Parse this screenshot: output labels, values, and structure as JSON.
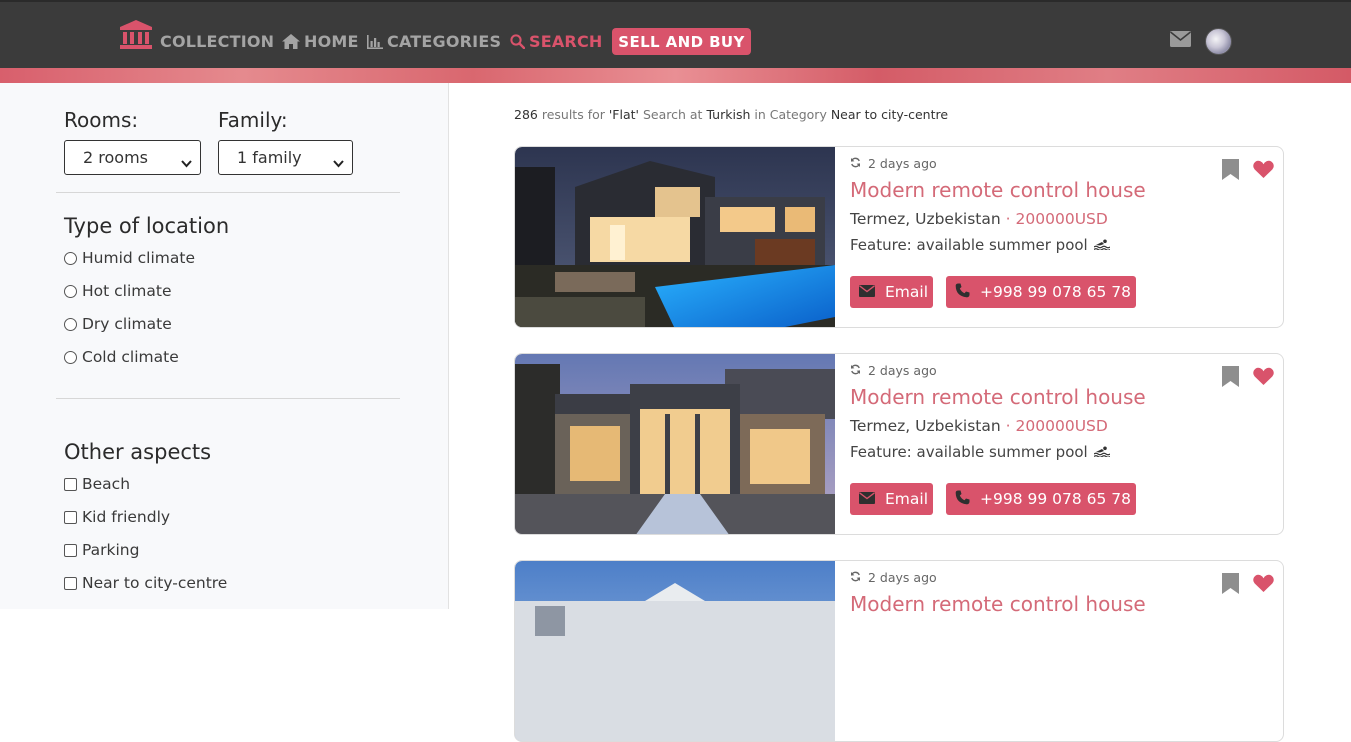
{
  "nav": {
    "logo_icon": "bank-building-icon",
    "items": [
      {
        "label": "COLLECTION",
        "icon": "",
        "active": false
      },
      {
        "label": "HOME",
        "icon": "home-icon",
        "active": false
      },
      {
        "label": "CATEGORIES",
        "icon": "bar-chart-icon",
        "active": false
      },
      {
        "label": "SEARCH",
        "icon": "search-icon",
        "active": true
      }
    ],
    "cta_label": "SELL AND BUY",
    "mail_icon": "envelope-icon",
    "avatar": "user-avatar"
  },
  "filters": {
    "rooms_label": "Rooms:",
    "rooms_value": "2 rooms",
    "family_label": "Family:",
    "family_value": "1 family",
    "location_heading": "Type of location",
    "location_options": [
      "Humid climate",
      "Hot climate",
      "Dry climate",
      "Cold climate"
    ],
    "aspects_heading": "Other aspects",
    "aspect_options": [
      "Beach",
      "Kid friendly",
      "Parking",
      "Near to city-centre"
    ]
  },
  "results": {
    "count": "286",
    "text_results_for": "results for",
    "query": "'Flat'",
    "text_search_at": "Search at",
    "language": "Turkish",
    "text_in_category": "in Category",
    "category": "Near to city-centre"
  },
  "listings": [
    {
      "time": "2 days ago",
      "title": "Modern remote control house",
      "location": "Termez, Uzbekistan",
      "separator": "·",
      "price": "200000USD",
      "feature": "Feature: available summer pool",
      "email_label": "Email",
      "phone_label": "+998 99 078 65 78"
    },
    {
      "time": "2 days ago",
      "title": "Modern remote control house",
      "location": "Termez, Uzbekistan",
      "separator": "·",
      "price": "200000USD",
      "feature": "Feature: available summer pool",
      "email_label": "Email",
      "phone_label": "+998 99 078 65 78"
    },
    {
      "time": "2 days ago",
      "title": "Modern remote control house"
    }
  ],
  "colors": {
    "accent": "#d9536b",
    "nav_bg": "#3b3b3b",
    "nav_text": "#a4a4a4",
    "title_pink": "#d46a78"
  }
}
